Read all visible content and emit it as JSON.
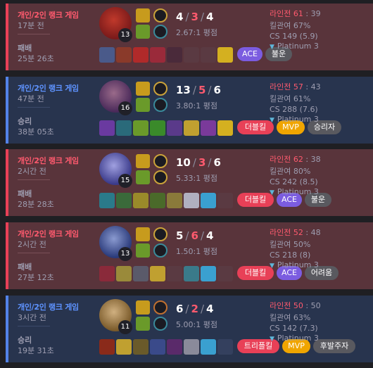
{
  "games": [
    {
      "result_type": "loss",
      "queue": "개인/2인 랭크 게임",
      "time_ago": "17분 전",
      "result": "패배",
      "duration": "25분 26초",
      "level": "13",
      "kills": "4",
      "deaths": "3",
      "assists": "4",
      "kda_ratio": "2.67:1 평점",
      "lane_label": "라인전",
      "lane_score": "61",
      "lane_opp": "39",
      "kill_participation": "킬관여 67%",
      "cs": "CS 149 (5.9)",
      "tier": "Platinum 3",
      "champ_colors": [
        "#7a1a1a",
        "#c0392b"
      ],
      "spells": [
        "#c79b1d",
        "#6a9a2a"
      ],
      "runes": [
        "#caa23a",
        "#3a8a9a"
      ],
      "items": [
        "#4a5a8a",
        "#8a3a2a",
        "#b02a2a",
        "#9a2a3a",
        "#4a2a3a",
        "",
        "",
        "#d4b020"
      ],
      "tags": [
        {
          "label": "ACE",
          "style": "purple"
        },
        {
          "label": "불운",
          "style": "gray"
        }
      ]
    },
    {
      "result_type": "win",
      "queue": "개인/2인 랭크 게임",
      "time_ago": "47분 전",
      "result": "승리",
      "duration": "38분 05초",
      "level": "16",
      "kills": "13",
      "deaths": "5",
      "assists": "6",
      "kda_ratio": "3.80:1 평점",
      "lane_label": "라인전",
      "lane_score": "57",
      "lane_opp": "43",
      "kill_participation": "킬관여 61%",
      "cs": "CS 288 (7.6)",
      "tier": "Platinum 3",
      "champ_colors": [
        "#4a2a5a",
        "#9a6a8a"
      ],
      "spells": [
        "#c79b1d",
        "#6a9a2a"
      ],
      "runes": [
        "#caa23a",
        "#3a8a9a"
      ],
      "items": [
        "#6a3aa0",
        "#2a6a7a",
        "#6a9a2a",
        "#3a8a2a",
        "#5a3a8a",
        "#c0a030",
        "#7a3a9a",
        "#d4b020"
      ],
      "tags": [
        {
          "label": "더블킬",
          "style": "red"
        },
        {
          "label": "MVP",
          "style": "gold"
        },
        {
          "label": "승리자",
          "style": "gray"
        }
      ]
    },
    {
      "result_type": "loss",
      "queue": "개인/2인 랭크 게임",
      "time_ago": "2시간 전",
      "result": "패배",
      "duration": "28분 28초",
      "level": "15",
      "kills": "10",
      "deaths": "3",
      "assists": "6",
      "kda_ratio": "5.33:1 평점",
      "lane_label": "라인전",
      "lane_score": "62",
      "lane_opp": "38",
      "kill_participation": "킬관여 80%",
      "cs": "CS 242 (8.5)",
      "tier": "Platinum 3",
      "champ_colors": [
        "#3a3a8a",
        "#a0a0e0"
      ],
      "spells": [
        "#c79b1d",
        "#6a9a2a"
      ],
      "runes": [
        "#caa23a",
        "#caa23a"
      ],
      "items": [
        "#2a7a8a",
        "#3a6a3a",
        "#9a8a2a",
        "#4a6a2a",
        "#8a7a3a",
        "#b0b0c0",
        "#3aa0d0",
        ""
      ],
      "tags": [
        {
          "label": "더블킬",
          "style": "red"
        },
        {
          "label": "ACE",
          "style": "purple"
        },
        {
          "label": "불운",
          "style": "gray"
        }
      ]
    },
    {
      "result_type": "loss",
      "queue": "개인/2인 랭크 게임",
      "time_ago": "2시간 전",
      "result": "패배",
      "duration": "27분 12초",
      "level": "13",
      "kills": "5",
      "deaths": "6",
      "assists": "4",
      "kda_ratio": "1.50:1 평점",
      "lane_label": "라인전",
      "lane_score": "52",
      "lane_opp": "48",
      "kill_participation": "킬관여 50%",
      "cs": "CS 218 (8)",
      "tier": "Platinum 3",
      "champ_colors": [
        "#2a3a7a",
        "#8a9ad0"
      ],
      "spells": [
        "#c79b1d",
        "#6a9a2a"
      ],
      "runes": [
        "#caa23a",
        "#3a8a9a"
      ],
      "items": [
        "#8a2a3a",
        "#9a8a3a",
        "#5a5a6a",
        "#c0a030",
        "",
        "#3a7a8a",
        "#3aa0d0",
        ""
      ],
      "tags": [
        {
          "label": "더블킬",
          "style": "red"
        },
        {
          "label": "ACE",
          "style": "purple"
        },
        {
          "label": "어려움",
          "style": "gray"
        }
      ]
    },
    {
      "result_type": "win",
      "queue": "개인/2인 랭크 게임",
      "time_ago": "3시간 전",
      "result": "승리",
      "duration": "19분 31초",
      "level": "11",
      "kills": "6",
      "deaths": "2",
      "assists": "4",
      "kda_ratio": "5.00:1 평점",
      "lane_label": "라인전",
      "lane_score": "50",
      "lane_opp": "50",
      "kill_participation": "킬관여 63%",
      "cs": "CS 142 (7.3)",
      "tier": "Platinum 3",
      "champ_colors": [
        "#7a5a2a",
        "#d0b080"
      ],
      "spells": [
        "#c79b1d",
        "#6a9a2a"
      ],
      "runes": [
        "#c07030",
        "#3a8a9a"
      ],
      "items": [
        "#8a2a1a",
        "#c0a030",
        "#6a5a2a",
        "#3a4a8a",
        "#5a2a6a",
        "#8a8a9a",
        "#3aa0d0",
        ""
      ],
      "tags": [
        {
          "label": "트리플킬",
          "style": "red"
        },
        {
          "label": "MVP",
          "style": "gold"
        },
        {
          "label": "후발주자",
          "style": "gray"
        }
      ]
    }
  ]
}
